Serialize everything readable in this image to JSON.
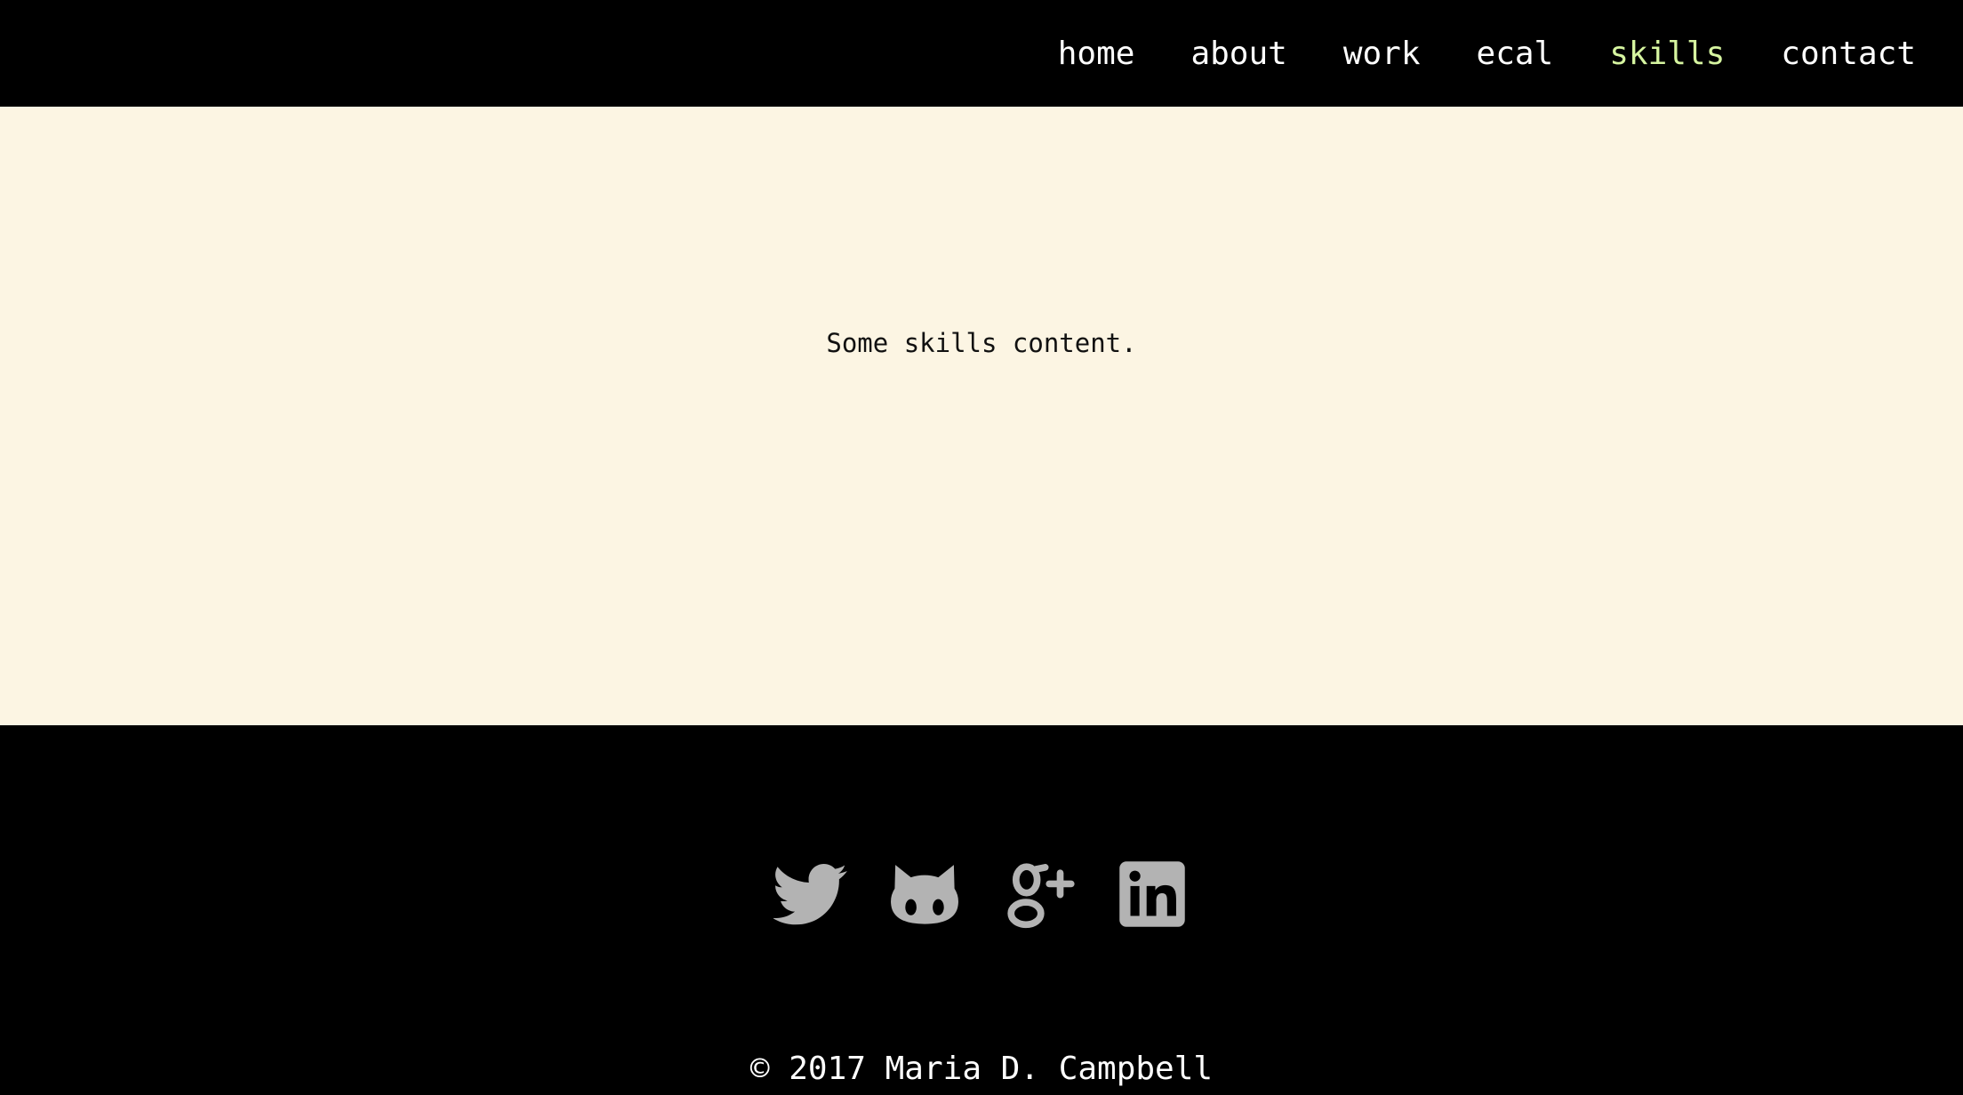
{
  "nav": {
    "items": [
      {
        "label": "home",
        "active": false
      },
      {
        "label": "about",
        "active": false
      },
      {
        "label": "work",
        "active": false
      },
      {
        "label": "ecal",
        "active": false
      },
      {
        "label": "skills",
        "active": true
      },
      {
        "label": "contact",
        "active": false
      }
    ],
    "active_color": "#d6f5a0"
  },
  "main": {
    "text": "Some skills content.",
    "background": "#fcf5e3"
  },
  "footer": {
    "social_icons": [
      "twitter-icon",
      "github-icon",
      "google-plus-icon",
      "linkedin-icon"
    ],
    "icon_color": "#b3b3b3",
    "copyright": "© 2017 Maria D. Campbell"
  }
}
